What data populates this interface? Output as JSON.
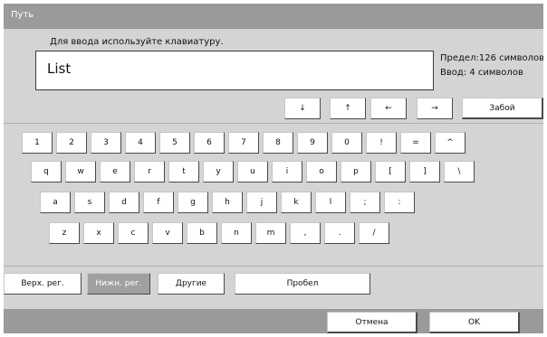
{
  "title": "Путь",
  "prompt": "Для ввода используйте клавиатуру.",
  "input_value": "List",
  "limit_label": "Предел:126 символов",
  "entered_label": "Ввод: 4 символов",
  "nav_keys": [
    "↓",
    "↑",
    "←",
    "→"
  ],
  "backspace_label": "Забой",
  "rows": [
    [
      "1",
      "2",
      "3",
      "4",
      "5",
      "6",
      "7",
      "8",
      "9",
      "0",
      "!",
      "=",
      "^"
    ],
    [
      "q",
      "w",
      "e",
      "r",
      "t",
      "y",
      "u",
      "i",
      "o",
      "p",
      "[",
      "]",
      "\\"
    ],
    [
      "a",
      "s",
      "d",
      "f",
      "g",
      "h",
      "j",
      "k",
      "l",
      ";",
      ":"
    ],
    [
      "z",
      "x",
      "c",
      "v",
      "b",
      "n",
      "m",
      ",",
      ".",
      "/"
    ]
  ],
  "upper_label": "Верх. рег.",
  "lower_label": "Нижн. рег.",
  "other_label": "Другие",
  "space_label": "Пробел",
  "cancel_label": "Отмена",
  "ok_label": "OK"
}
